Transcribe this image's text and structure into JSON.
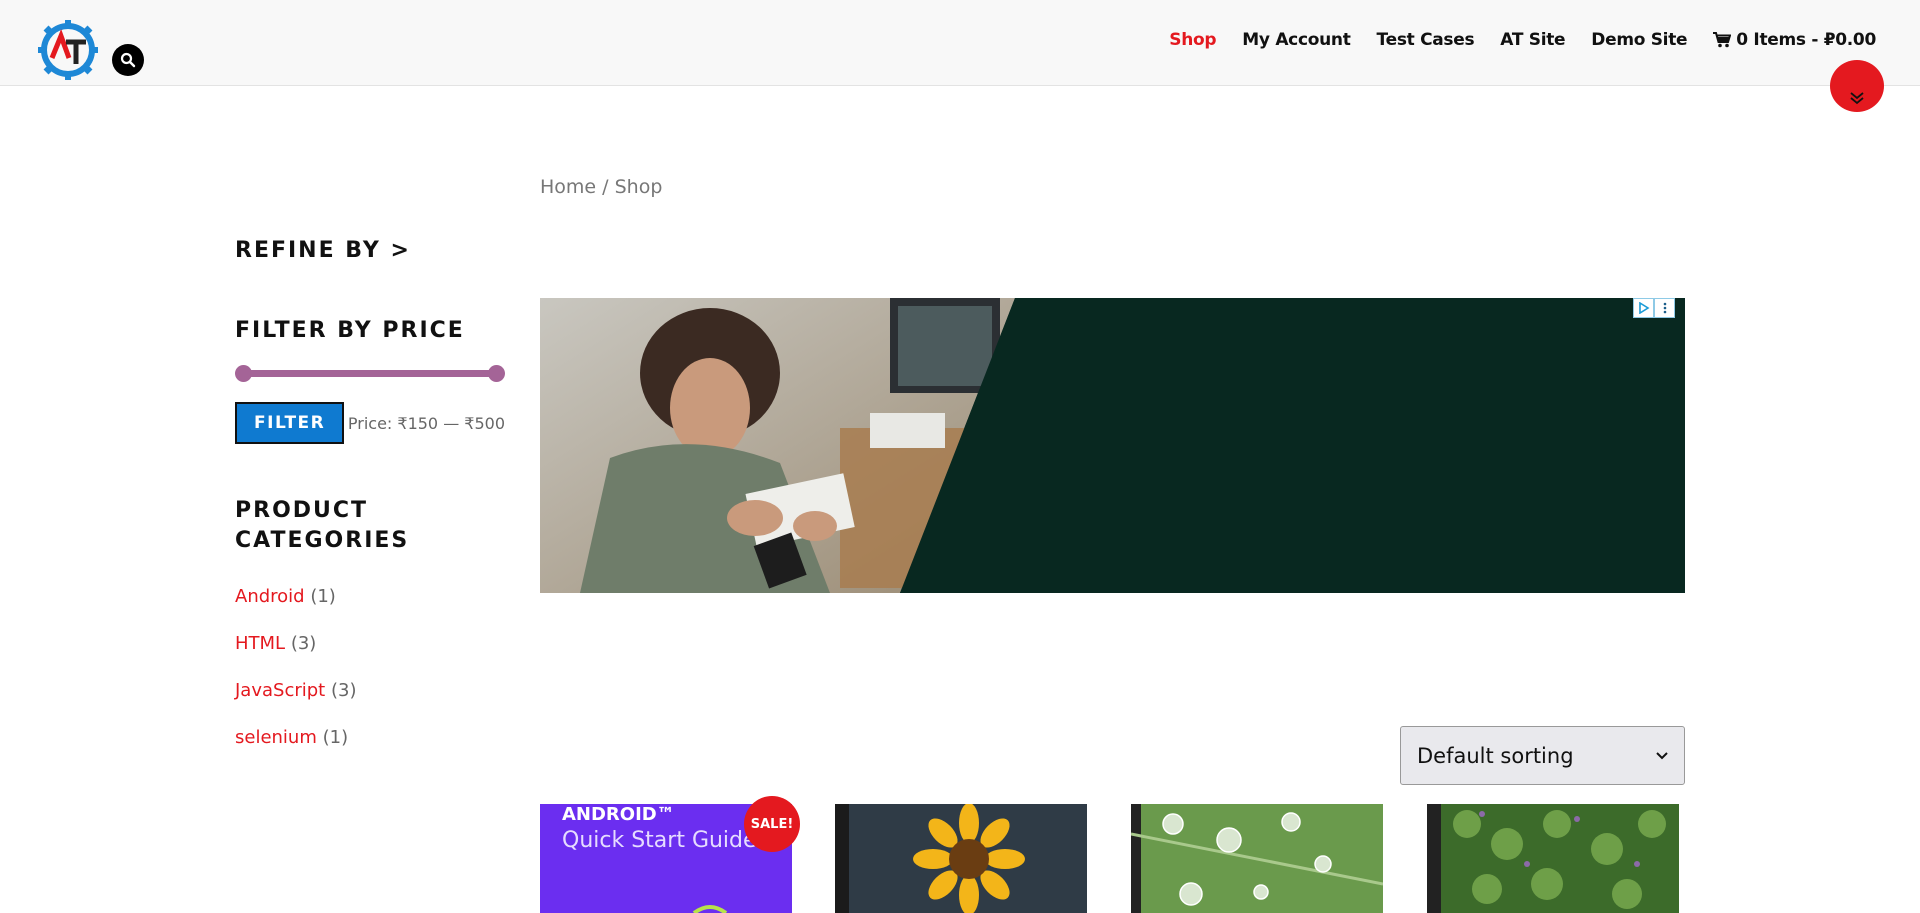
{
  "header": {
    "nav": [
      "Shop",
      "My Account",
      "Test Cases",
      "AT Site",
      "Demo Site"
    ],
    "cart": "0 Items - ₽0.00"
  },
  "breadcrumb": {
    "home": "Home",
    "sep": " / ",
    "current": "Shop"
  },
  "sidebar": {
    "refine": "REFINE BY >",
    "filter_title": "FILTER BY PRICE",
    "filter_button": "FILTER",
    "price_label": "Price: ₹150 — ₹500",
    "price_min": 150,
    "price_max": 500,
    "categories_title": "PRODUCT CATEGORIES",
    "categories": [
      {
        "name": "Android",
        "count": "(1)"
      },
      {
        "name": "HTML",
        "count": "(3)"
      },
      {
        "name": "JavaScript",
        "count": "(3)"
      },
      {
        "name": "selenium",
        "count": "(1)"
      }
    ]
  },
  "sorting": {
    "selected": "Default sorting"
  },
  "products": {
    "sale_badge": "SALE!",
    "p1_line1": "ANDROID™",
    "p1_line2": "Quick Start Guide"
  },
  "colors": {
    "accent": "#e4191f",
    "button": "#0f7ad0",
    "slider": "#a46497"
  }
}
